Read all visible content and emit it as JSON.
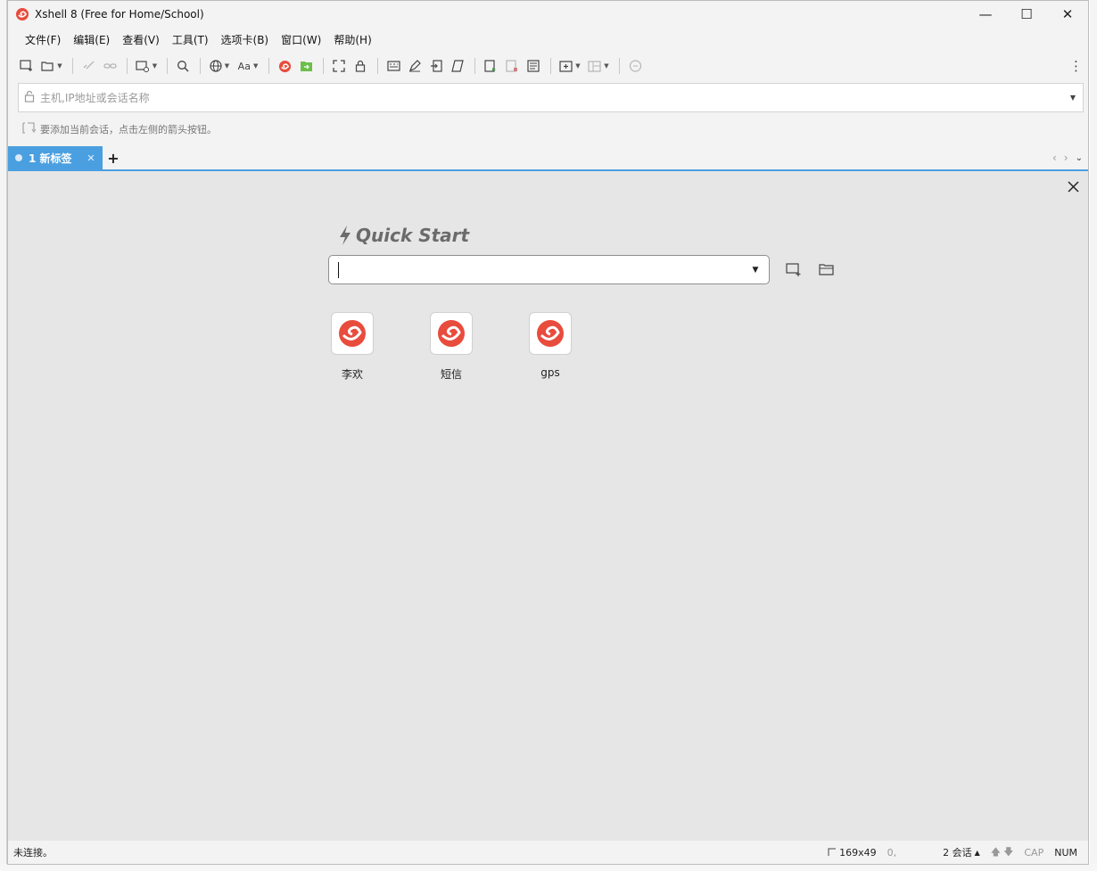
{
  "window": {
    "title": "Xshell 8 (Free for Home/School)",
    "controls": {
      "minimize": "—",
      "maximize": "☐",
      "close": "✕"
    }
  },
  "menu": [
    "文件(F)",
    "编辑(E)",
    "查看(V)",
    "工具(T)",
    "选项卡(B)",
    "窗口(W)",
    "帮助(H)"
  ],
  "toolbar": {
    "font_label": "Aa",
    "more": "⋮"
  },
  "address": {
    "placeholder": "主机,IP地址或会话名称"
  },
  "hint": {
    "text": "要添加当前会话，点击左侧的箭头按钮。"
  },
  "tabs": {
    "active_label": "1 新标签",
    "close": "✕",
    "add": "+"
  },
  "quick_start": {
    "title": "Quick Start",
    "input_value": "",
    "sessions": [
      {
        "label": "李欢"
      },
      {
        "label": "短信"
      },
      {
        "label": "gps"
      }
    ]
  },
  "status": {
    "connection": "未连接。",
    "size": "169x49",
    "cursor": "0,",
    "sessions": "2 会话",
    "cap": "CAP",
    "num": "NUM"
  },
  "colors": {
    "accent": "#4a9fe0",
    "brand": "#e84c3d",
    "content_bg": "#e6e6e6"
  }
}
